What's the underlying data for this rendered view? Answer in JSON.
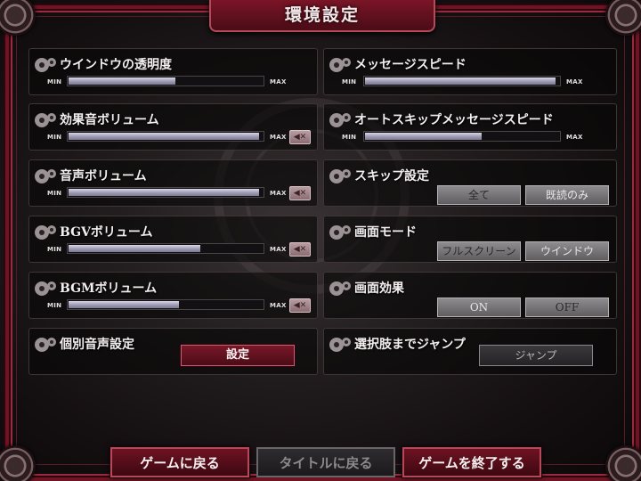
{
  "title": "環境設定",
  "min_label": "MIN",
  "max_label": "MAX",
  "mute_icon": "speaker-mute-icon",
  "gear_icon": "gear-icon",
  "left_sliders": [
    {
      "label": "ウインドウの透明度",
      "level": 0.55,
      "has_mute": false
    },
    {
      "label": "効果音ボリューム",
      "level": 0.98,
      "has_mute": true
    },
    {
      "label": "音声ボリューム",
      "level": 0.98,
      "has_mute": true
    },
    {
      "label": "BGVボリューム",
      "level": 0.68,
      "has_mute": true
    },
    {
      "label": "BGMボリューム",
      "level": 0.57,
      "has_mute": true
    }
  ],
  "individual_voice": {
    "label": "個別音声設定",
    "button": "設定"
  },
  "right": {
    "message_speed": {
      "label": "メッセージスピード",
      "level": 0.98
    },
    "auto_speed": {
      "label": "オートスキップメッセージスピード",
      "level": 0.6
    },
    "skip": {
      "label": "スキップ設定",
      "options": [
        "全て",
        "既読のみ"
      ]
    },
    "screen_mode": {
      "label": "画面モード",
      "options": [
        "フルスクリーン",
        "ウインドウ"
      ]
    },
    "screen_effect": {
      "label": "画面効果",
      "options": [
        "ON",
        "OFF"
      ]
    },
    "jump": {
      "label": "選択肢までジャンプ",
      "button": "ジャンプ"
    }
  },
  "bottom_buttons": [
    "ゲームに戻る",
    "タイトルに戻る",
    "ゲームを終了する"
  ],
  "colors": {
    "accent_red": "#6e1222",
    "slider_fill": "#b8b6cc"
  }
}
